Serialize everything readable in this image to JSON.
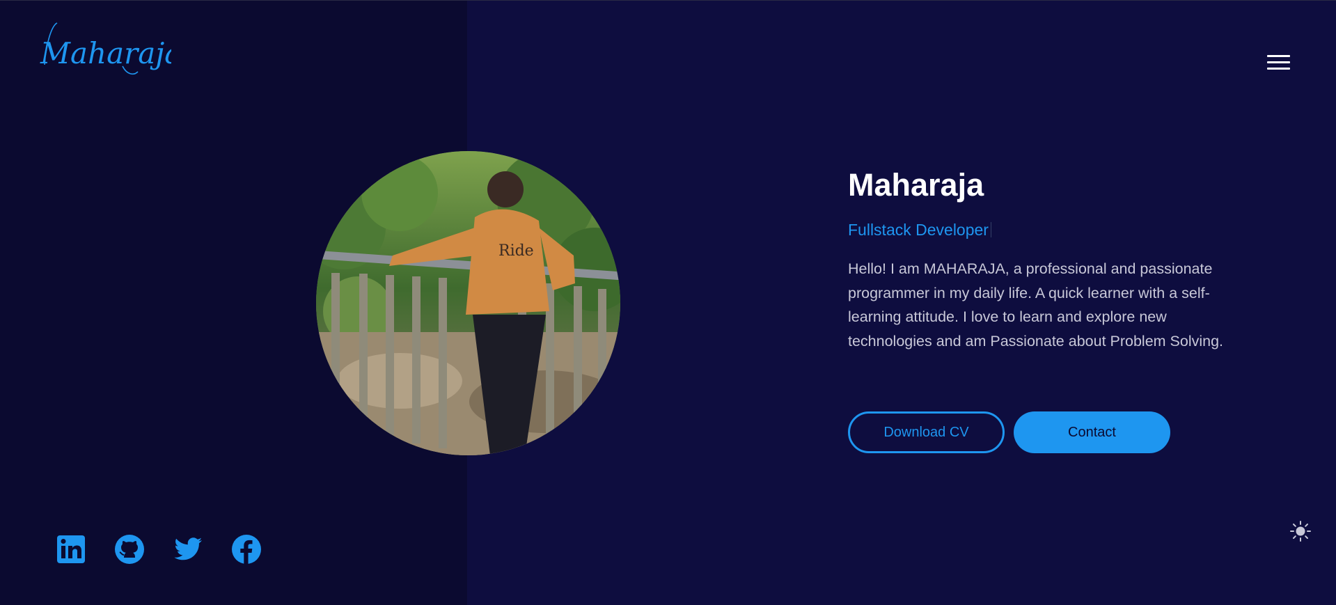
{
  "header": {
    "logo_text": "Maharaja",
    "menu_icon": "hamburger-menu-icon"
  },
  "hero": {
    "name": "Maharaja",
    "role": "Fullstack Developer",
    "bio": "Hello! I am MAHARAJA, a professional and passionate programmer in my daily life. A quick learner with a self-learning attitude. I love to learn and explore new technologies and am Passionate about Problem Solving.",
    "download_cv_label": "Download CV",
    "contact_label": "Contact",
    "photo_icon": "profile-photo"
  },
  "socials": [
    {
      "icon": "linkedin-icon"
    },
    {
      "icon": "github-icon"
    },
    {
      "icon": "twitter-icon"
    },
    {
      "icon": "facebook-icon"
    }
  ],
  "theme_toggle": {
    "icon": "sun-icon"
  },
  "colors": {
    "background": "#0e0d3f",
    "left_panel": "#0b0a30",
    "accent": "#1e96f0",
    "heading": "#ffffff",
    "body_text": "#c8c8d8"
  }
}
